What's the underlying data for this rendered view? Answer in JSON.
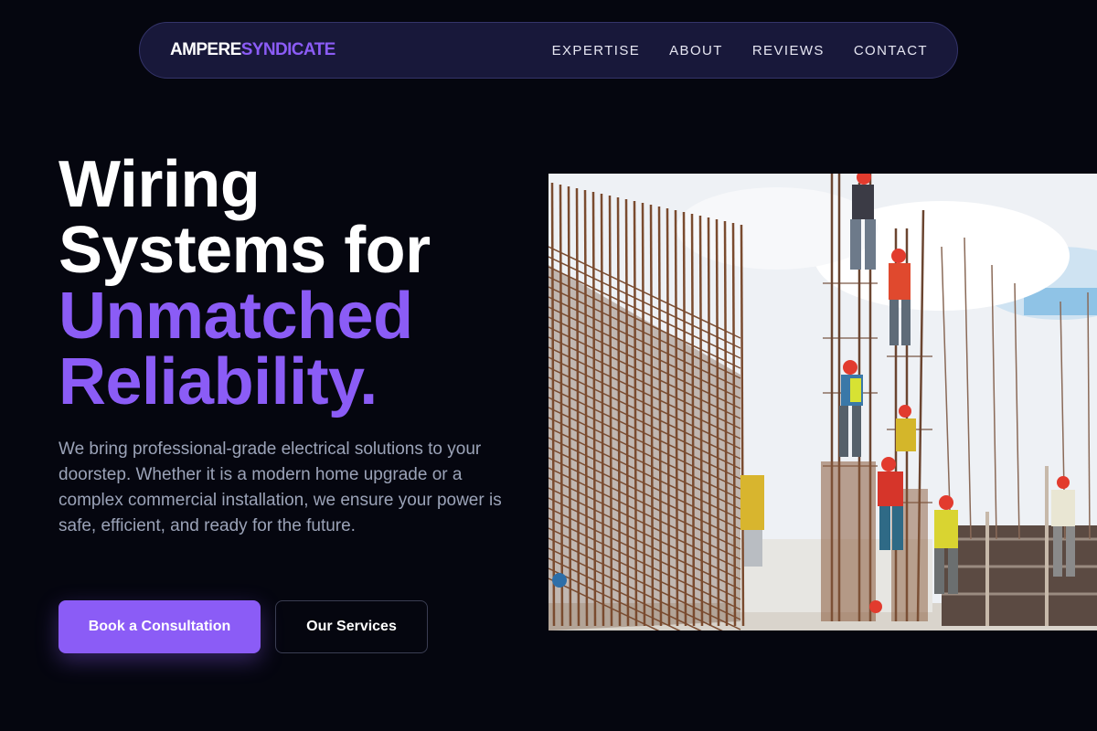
{
  "nav": {
    "logo_part1": "AMPERE",
    "logo_part2": "SYNDICATE",
    "links": [
      "EXPERTISE",
      "ABOUT",
      "REVIEWS",
      "CONTACT"
    ]
  },
  "hero": {
    "headline_line1": "Wiring",
    "headline_line2": "Systems for",
    "headline_line3": "Unmatched",
    "headline_line4": "Reliability.",
    "lead": "We bring professional-grade electrical solutions to your doorstep. Whether it is a modern home upgrade or a complex commercial installation, we ensure your power is safe, efficient, and ready for the future.",
    "primary_button": "Book a Consultation",
    "secondary_button": "Our Services"
  },
  "image": {
    "subject": "construction workers climbing rebar columns"
  },
  "colors": {
    "background": "#05060f",
    "accent": "#8b5cf6",
    "nav_background": "#18183a",
    "body_text": "#9ba3b8"
  }
}
